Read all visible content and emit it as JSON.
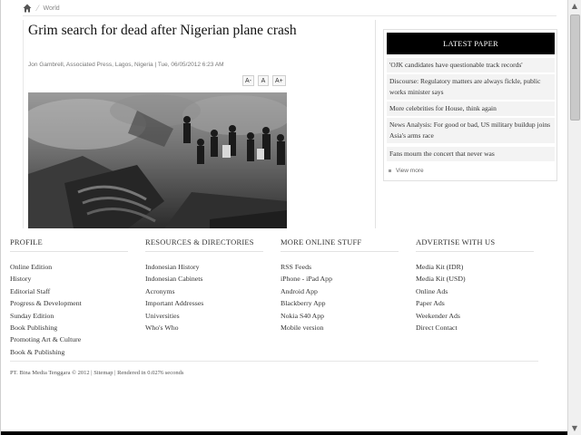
{
  "breadcrumb": {
    "section": "World"
  },
  "article": {
    "title": "Grim search for dead after Nigerian plane crash",
    "byline": "Jon Gambrell, Associated Press, Lagos, Nigeria | Tue, 06/05/2012 6:23 AM",
    "font_controls": [
      "A-",
      "A",
      "A+"
    ]
  },
  "latest_paper": {
    "heading": "LATEST PAPER",
    "items": [
      "'OJK candidates have questionable track records'",
      "Discourse: Regulatory matters are always fickle, public works minister says",
      "More celebrities for House, think again",
      "News Analysis: For good or bad, US military buildup joins Asia's arms race",
      "Fans mourn the concert that never was"
    ],
    "view_more": "View more"
  },
  "footer": {
    "columns": [
      {
        "heading": "PROFILE",
        "links": [
          "Online Edition",
          "History",
          "Editorial Staff",
          "Progress & Development",
          "Sunday Edition",
          "Book Publishing",
          "Promoting Art & Culture",
          "Book & Publishing"
        ]
      },
      {
        "heading": "RESOURCES & DIRECTORIES",
        "links": [
          "Indonesian History",
          "Indonesian Cabinets",
          "Acronyms",
          "Important Addresses",
          "Universities",
          "Who's Who"
        ]
      },
      {
        "heading": "MORE ONLINE STUFF",
        "links": [
          "RSS Feeds",
          "iPhone - iPad App",
          "Android App",
          "Blackberry App",
          "Nokia S40 App",
          "Mobile version"
        ]
      },
      {
        "heading": "ADVERTISE WITH US",
        "links": [
          "Media Kit (IDR)",
          "Media Kit (USD)",
          "Online Ads",
          "Paper Ads",
          "Weekender Ads",
          "Direct Contact"
        ]
      }
    ],
    "copyright_prefix": "PT. Bina Media Tenggara © 2012 |",
    "sitemap": "Sitemap",
    "rendered": "| Rendered in 0.0276 seconds"
  },
  "colors": {
    "header_bg": "#000000",
    "item_bg": "#f3f3f3"
  }
}
